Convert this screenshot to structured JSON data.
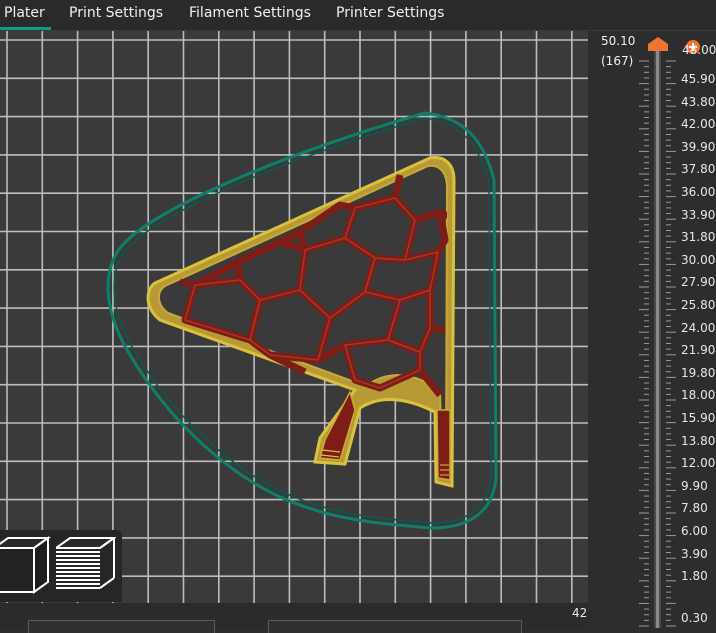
{
  "tabs": [
    {
      "label": "Plater",
      "active": true
    },
    {
      "label": "Print Settings",
      "active": false
    },
    {
      "label": "Filament Settings",
      "active": false
    },
    {
      "label": "Printer Settings",
      "active": false
    }
  ],
  "layer_slider": {
    "top_value": "50.10",
    "top_layer": "(167)",
    "ticks": [
      "48.00",
      "45.90",
      "43.80",
      "42.00",
      "39.90",
      "37.80",
      "36.00",
      "33.90",
      "31.80",
      "30.00",
      "27.90",
      "25.80",
      "24.00",
      "21.90",
      "19.80",
      "18.00",
      "15.90",
      "13.80",
      "12.00",
      "9.90",
      "7.80",
      "6.00",
      "3.90",
      "1.80"
    ],
    "top_tick": "48.00",
    "bottom_value": "0.30",
    "thumb_color": "#ee7431",
    "track_color": "#5a5a5a"
  },
  "horizontal_slider": {
    "count": "42"
  },
  "view_toolbar": {
    "items": [
      {
        "icon": "cube-view-icon"
      },
      {
        "icon": "layers-view-icon"
      }
    ]
  },
  "colors": {
    "skirt": "#0d8069",
    "perimeter_outer": "#c8a93a",
    "perimeter_inner": "#d9c13f",
    "infill": "#7d1d15",
    "grid": "#bdbdbd",
    "accent": "#119b87"
  }
}
